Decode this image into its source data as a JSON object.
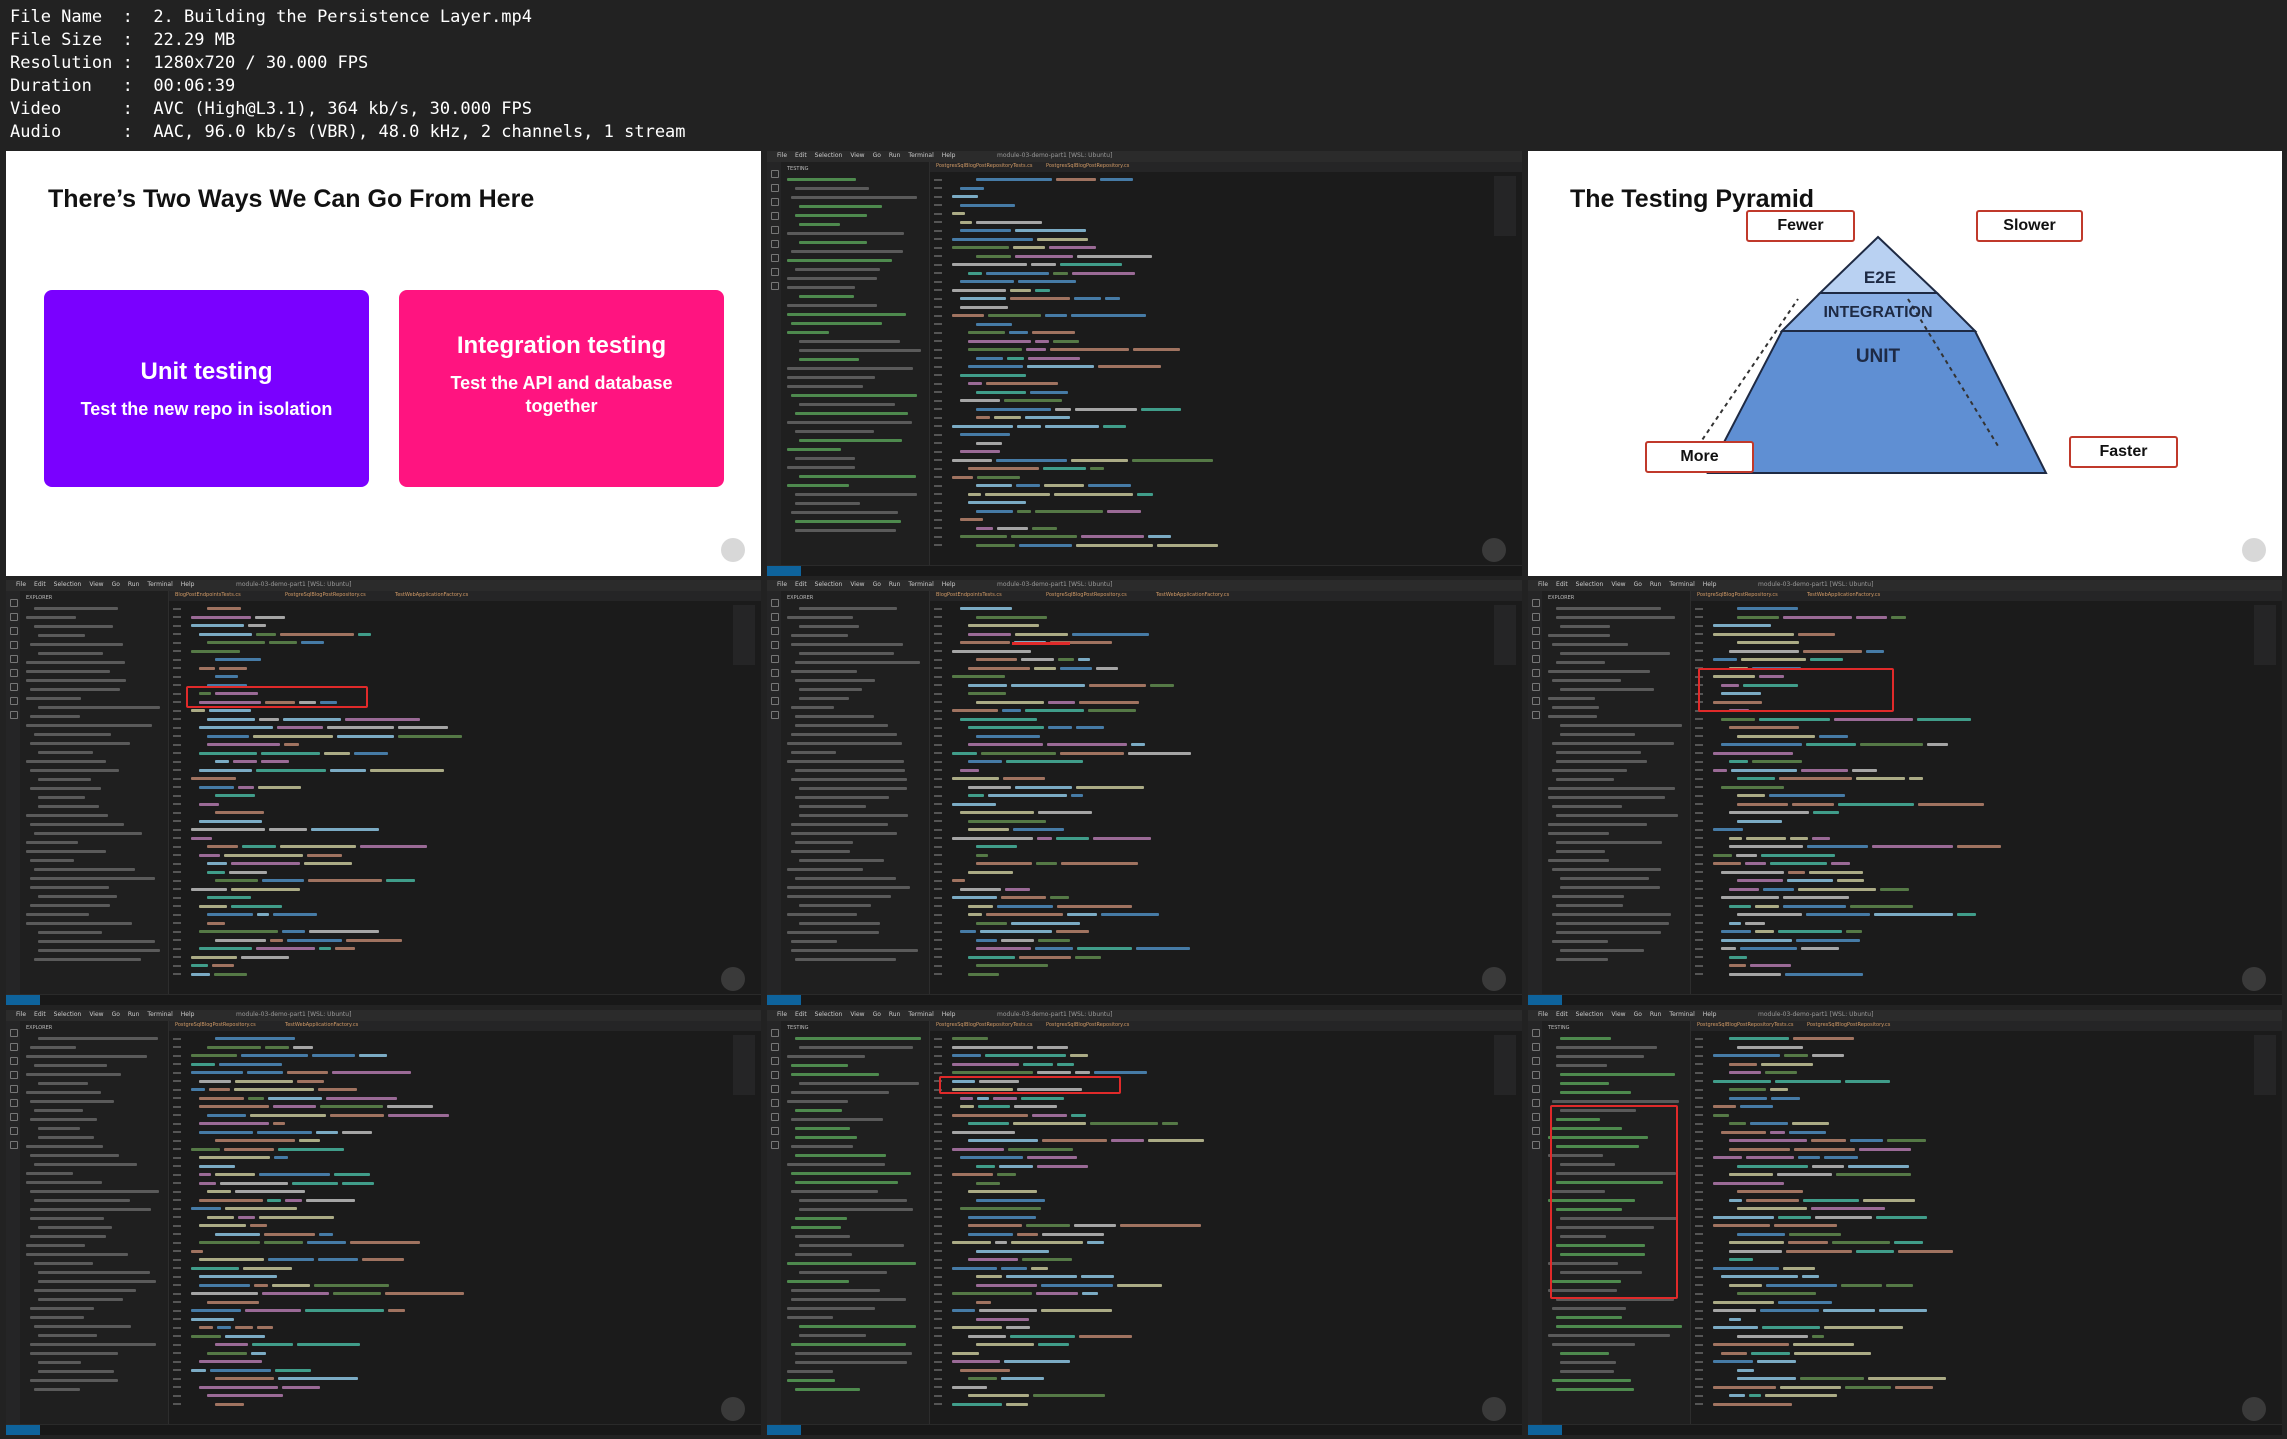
{
  "file_info": [
    {
      "label": "File Name",
      "value": "2. Building the Persistence Layer.mp4"
    },
    {
      "label": "File Size",
      "value": "22.29 MB"
    },
    {
      "label": "Resolution",
      "value": "1280x720 / 30.000 FPS"
    },
    {
      "label": "Duration",
      "value": "00:06:39"
    },
    {
      "label": "Video",
      "value": "AVC (High@L3.1), 364 kb/s, 30.000 FPS"
    },
    {
      "label": "Audio",
      "value": "AAC, 96.0 kb/s (VBR), 48.0 kHz, 2 channels, 1 stream"
    }
  ],
  "slide1": {
    "title": "There’s Two Ways We Can Go From Here",
    "card_left": {
      "title": "Unit testing",
      "subtitle": "Test the new repo in isolation",
      "color": "#7a00ff"
    },
    "card_right": {
      "title": "Integration testing",
      "subtitle": "Test the API and database together",
      "color": "#ff1480"
    }
  },
  "slide2": {
    "title": "The Testing Pyramid",
    "labels": {
      "fewer": "Fewer",
      "slower": "Slower",
      "more": "More",
      "faster": "Faster"
    },
    "tiers": {
      "top": "E2E",
      "middle": "INTEGRATION",
      "bottom": "UNIT"
    },
    "colors": {
      "top": "#b9d1f2",
      "middle": "#8ab0e6",
      "bottom": "#5f8fd3",
      "outline": "#1e2a44",
      "box_border": "#c0392b"
    }
  },
  "ide": {
    "menu": [
      "File",
      "Edit",
      "Selection",
      "View",
      "Go",
      "Run",
      "Terminal",
      "Help"
    ],
    "window_title": "module-03-demo-part1 [WSL: Ubuntu]",
    "sidebar_titles": {
      "testing": "TESTING",
      "explorer": "EXPLORER"
    },
    "tabs": {
      "a": [
        "PostgresSqlBlogPostRepositoryTests.cs",
        "PostgresSqlBlogPostRepository.cs"
      ],
      "b": [
        "BlogPostEndpointsTests.cs",
        "PostgreSqlBlogPostRepository.cs",
        "TestWebApplicationFactory.cs"
      ],
      "c": [
        "PostgreSqlBlogPostRepository.cs",
        "TestWebApplicationFactory.cs"
      ]
    }
  }
}
